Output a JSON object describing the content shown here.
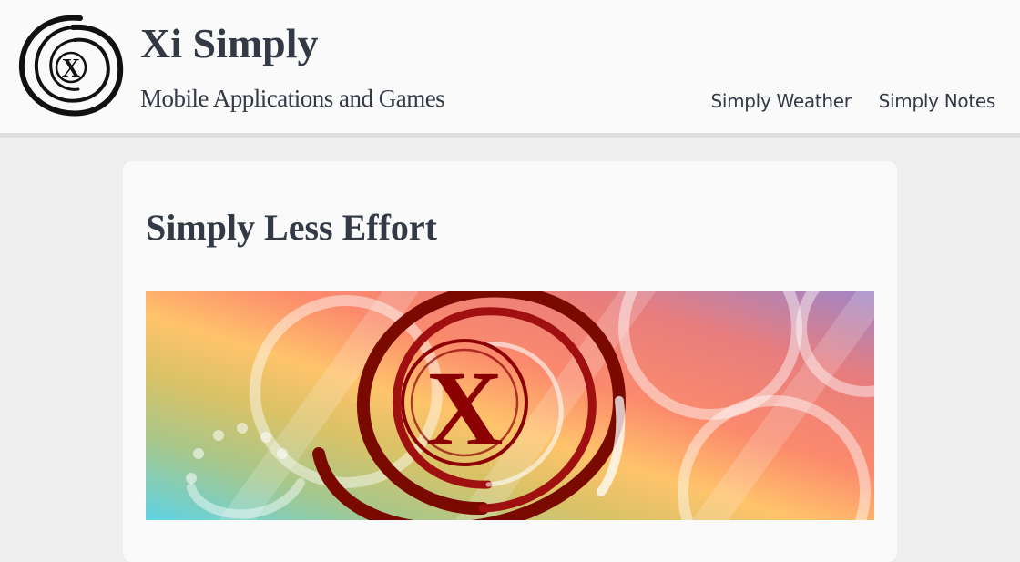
{
  "site": {
    "title": "Xi Simply",
    "tagline": "Mobile Applications and Games",
    "logo_icon": "xi-spiral-logo-icon"
  },
  "nav": {
    "items": [
      {
        "label": "Simply Weather"
      },
      {
        "label": "Simply Notes"
      }
    ]
  },
  "post": {
    "title": "Simply Less Effort",
    "banner_icon": "xi-spiral-banner-image"
  },
  "colors": {
    "text": "#333a45",
    "header_bg": "#fafafa",
    "page_bg": "#eeeeee",
    "logo_dark": "#111111",
    "banner_mark": "#8b0000"
  }
}
